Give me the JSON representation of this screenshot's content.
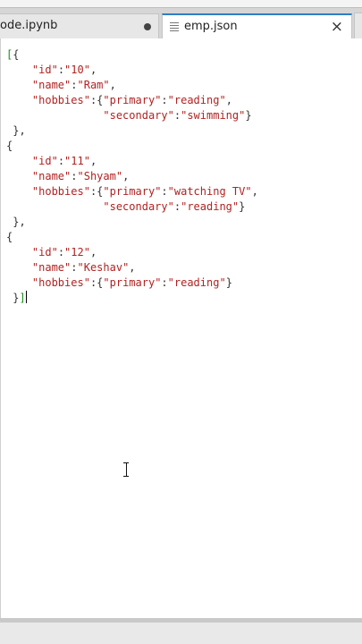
{
  "tabs": {
    "notebook": {
      "label": "ode.ipynb"
    },
    "json": {
      "label": "emp.json",
      "close": "×"
    }
  },
  "editor": {
    "lines": [
      [
        {
          "t": "[",
          "c": "bracket-hl"
        },
        {
          "t": "{",
          "c": "pun"
        }
      ],
      [
        {
          "t": "    ",
          "c": "pun"
        },
        {
          "t": "\"id\"",
          "c": "str"
        },
        {
          "t": ":",
          "c": "pun"
        },
        {
          "t": "\"10\"",
          "c": "str"
        },
        {
          "t": ",",
          "c": "pun"
        }
      ],
      [
        {
          "t": "    ",
          "c": "pun"
        },
        {
          "t": "\"name\"",
          "c": "str"
        },
        {
          "t": ":",
          "c": "pun"
        },
        {
          "t": "\"Ram\"",
          "c": "str"
        },
        {
          "t": ",",
          "c": "pun"
        }
      ],
      [
        {
          "t": "    ",
          "c": "pun"
        },
        {
          "t": "\"hobbies\"",
          "c": "str"
        },
        {
          "t": ":{",
          "c": "pun"
        },
        {
          "t": "\"primary\"",
          "c": "str"
        },
        {
          "t": ":",
          "c": "pun"
        },
        {
          "t": "\"reading\"",
          "c": "str"
        },
        {
          "t": ",",
          "c": "pun"
        }
      ],
      [
        {
          "t": "               ",
          "c": "pun"
        },
        {
          "t": "\"secondary\"",
          "c": "str"
        },
        {
          "t": ":",
          "c": "pun"
        },
        {
          "t": "\"swimming\"",
          "c": "str"
        },
        {
          "t": "}",
          "c": "pun"
        }
      ],
      [
        {
          "t": " },",
          "c": "pun"
        }
      ],
      [
        {
          "t": "{",
          "c": "pun"
        }
      ],
      [
        {
          "t": "    ",
          "c": "pun"
        },
        {
          "t": "\"id\"",
          "c": "str"
        },
        {
          "t": ":",
          "c": "pun"
        },
        {
          "t": "\"11\"",
          "c": "str"
        },
        {
          "t": ",",
          "c": "pun"
        }
      ],
      [
        {
          "t": "    ",
          "c": "pun"
        },
        {
          "t": "\"name\"",
          "c": "str"
        },
        {
          "t": ":",
          "c": "pun"
        },
        {
          "t": "\"Shyam\"",
          "c": "str"
        },
        {
          "t": ",",
          "c": "pun"
        }
      ],
      [
        {
          "t": "    ",
          "c": "pun"
        },
        {
          "t": "\"hobbies\"",
          "c": "str"
        },
        {
          "t": ":{",
          "c": "pun"
        },
        {
          "t": "\"primary\"",
          "c": "str"
        },
        {
          "t": ":",
          "c": "pun"
        },
        {
          "t": "\"watching TV\"",
          "c": "str"
        },
        {
          "t": ",",
          "c": "pun"
        }
      ],
      [
        {
          "t": "               ",
          "c": "pun"
        },
        {
          "t": "\"secondary\"",
          "c": "str"
        },
        {
          "t": ":",
          "c": "pun"
        },
        {
          "t": "\"reading\"",
          "c": "str"
        },
        {
          "t": "}",
          "c": "pun"
        }
      ],
      [
        {
          "t": " },",
          "c": "pun"
        }
      ],
      [
        {
          "t": "{",
          "c": "pun"
        }
      ],
      [
        {
          "t": "    ",
          "c": "pun"
        },
        {
          "t": "\"id\"",
          "c": "str"
        },
        {
          "t": ":",
          "c": "pun"
        },
        {
          "t": "\"12\"",
          "c": "str"
        },
        {
          "t": ",",
          "c": "pun"
        }
      ],
      [
        {
          "t": "    ",
          "c": "pun"
        },
        {
          "t": "\"name\"",
          "c": "str"
        },
        {
          "t": ":",
          "c": "pun"
        },
        {
          "t": "\"Keshav\"",
          "c": "str"
        },
        {
          "t": ",",
          "c": "pun"
        }
      ],
      [
        {
          "t": "    ",
          "c": "pun"
        },
        {
          "t": "\"hobbies\"",
          "c": "str"
        },
        {
          "t": ":{",
          "c": "pun"
        },
        {
          "t": "\"primary\"",
          "c": "str"
        },
        {
          "t": ":",
          "c": "pun"
        },
        {
          "t": "\"reading\"",
          "c": "str"
        },
        {
          "t": "}",
          "c": "pun"
        }
      ],
      [
        {
          "t": " }",
          "c": "pun"
        },
        {
          "t": "]",
          "c": "bracket-hl"
        }
      ]
    ]
  },
  "colors": {
    "active_tab_accent": "#2f7ec5",
    "string": "#b22222",
    "matched_bracket": "#1a8f1a"
  }
}
